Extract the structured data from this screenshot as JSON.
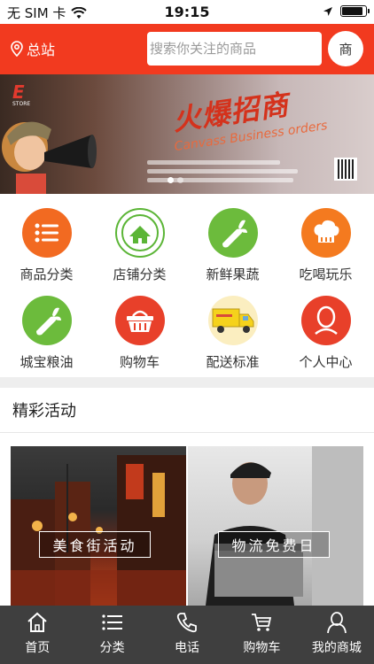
{
  "status_bar": {
    "carrier": "无 SIM 卡",
    "time": "19:15",
    "battery_level": 0.9
  },
  "header": {
    "location": "总站",
    "search_placeholder": "搜索你关注的商品",
    "shop_button": "商"
  },
  "banner": {
    "logo": "E",
    "logo_sub": "STORE",
    "headline": "火爆招商",
    "subtitle_en": "Canvass Business orders",
    "active_slide": 1,
    "slide_count": 2
  },
  "categories": [
    {
      "label": "商品分类",
      "icon": "list-icon",
      "color": "#f26a21"
    },
    {
      "label": "店铺分类",
      "icon": "farm-badge-icon",
      "color": "#5bb536"
    },
    {
      "label": "新鲜果蔬",
      "icon": "vegetable-icon",
      "color": "#6cbb3c"
    },
    {
      "label": "吃喝玩乐",
      "icon": "chef-hat-icon",
      "color": "#f47a1f"
    },
    {
      "label": "城宝粮油",
      "icon": "vegetable-icon",
      "color": "#6cbb3c"
    },
    {
      "label": "购物车",
      "icon": "basket-icon",
      "color": "#e8402a"
    },
    {
      "label": "配送标准",
      "icon": "delivery-truck-icon",
      "color": "#f5d21c"
    },
    {
      "label": "个人中心",
      "icon": "user-icon",
      "color": "#e8402a"
    }
  ],
  "section": {
    "title": "精彩活动"
  },
  "activities": [
    {
      "label": "美食街活动",
      "image": "food-street-photo"
    },
    {
      "label": "物流免费日",
      "image": "delivery-man-photo"
    }
  ],
  "tabbar": [
    {
      "label": "首页",
      "icon": "home-icon"
    },
    {
      "label": "分类",
      "icon": "menu-icon"
    },
    {
      "label": "电话",
      "icon": "phone-icon"
    },
    {
      "label": "购物车",
      "icon": "cart-icon"
    },
    {
      "label": "我的商城",
      "icon": "user-icon"
    }
  ]
}
